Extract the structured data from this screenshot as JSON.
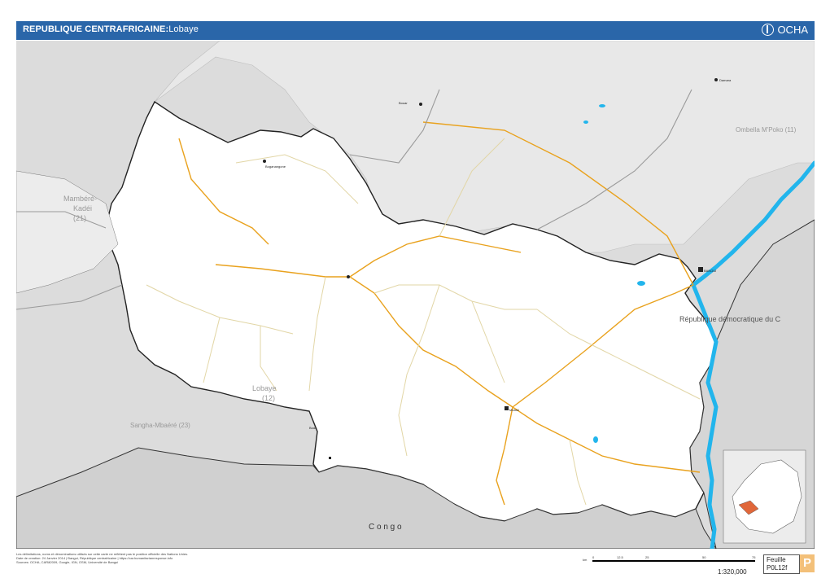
{
  "header": {
    "title_main": "REPUBLIQUE CENTRAFRICAINE:",
    "title_sub": "Lobaye",
    "logo_text": "OCHA",
    "color": "#2a66a9"
  },
  "map": {
    "colors": {
      "outside": "#dcdcdc",
      "prefecture": "#ffffff",
      "river": "#22b5ec",
      "road_main": "#e9a21e",
      "road_secondary": "#e2d6a6",
      "border": "#333333",
      "inset_highlight": "#e0673a"
    },
    "region_labels": {
      "lobaye": "Lobaye",
      "lobaye_code": "(12)",
      "mambere": "Mambéré-",
      "kadei": "Kadéi",
      "mambere_code": "(21)",
      "sangha": "Sangha-Mbaéré (23)",
      "ombella": "Ombella M'Poko (11)",
      "rdc": "République démocratique du C",
      "congo": "C o n g o"
    },
    "towns": {
      "boda": "Boda",
      "mbaiki": "Mbaïki",
      "bangui": "BANGUI",
      "bouar": "Bouar",
      "boganangone": "Boganangone",
      "damara": "Damara"
    }
  },
  "footer": {
    "disclaimer": "Les délimitations, noms et dénominations utilisés sur cette carte ne reflètent pas le position officielle des Nations Unies.",
    "date_line": "Date de creation: 24 Janvier 2014 | Bangui, République centrafricaine | https://car.humanitarianresponse.info",
    "sources": "Sources: OCHA, CARã2009, Google, IGN, OSM, Université de Bangui"
  },
  "scale": {
    "unit": "km",
    "ticks": [
      "0",
      "12.5",
      "25",
      "50",
      "75"
    ],
    "ratio": "1:320,000"
  },
  "sheet": {
    "label": "Feuille",
    "code": "P0L12f",
    "letter": "P"
  }
}
